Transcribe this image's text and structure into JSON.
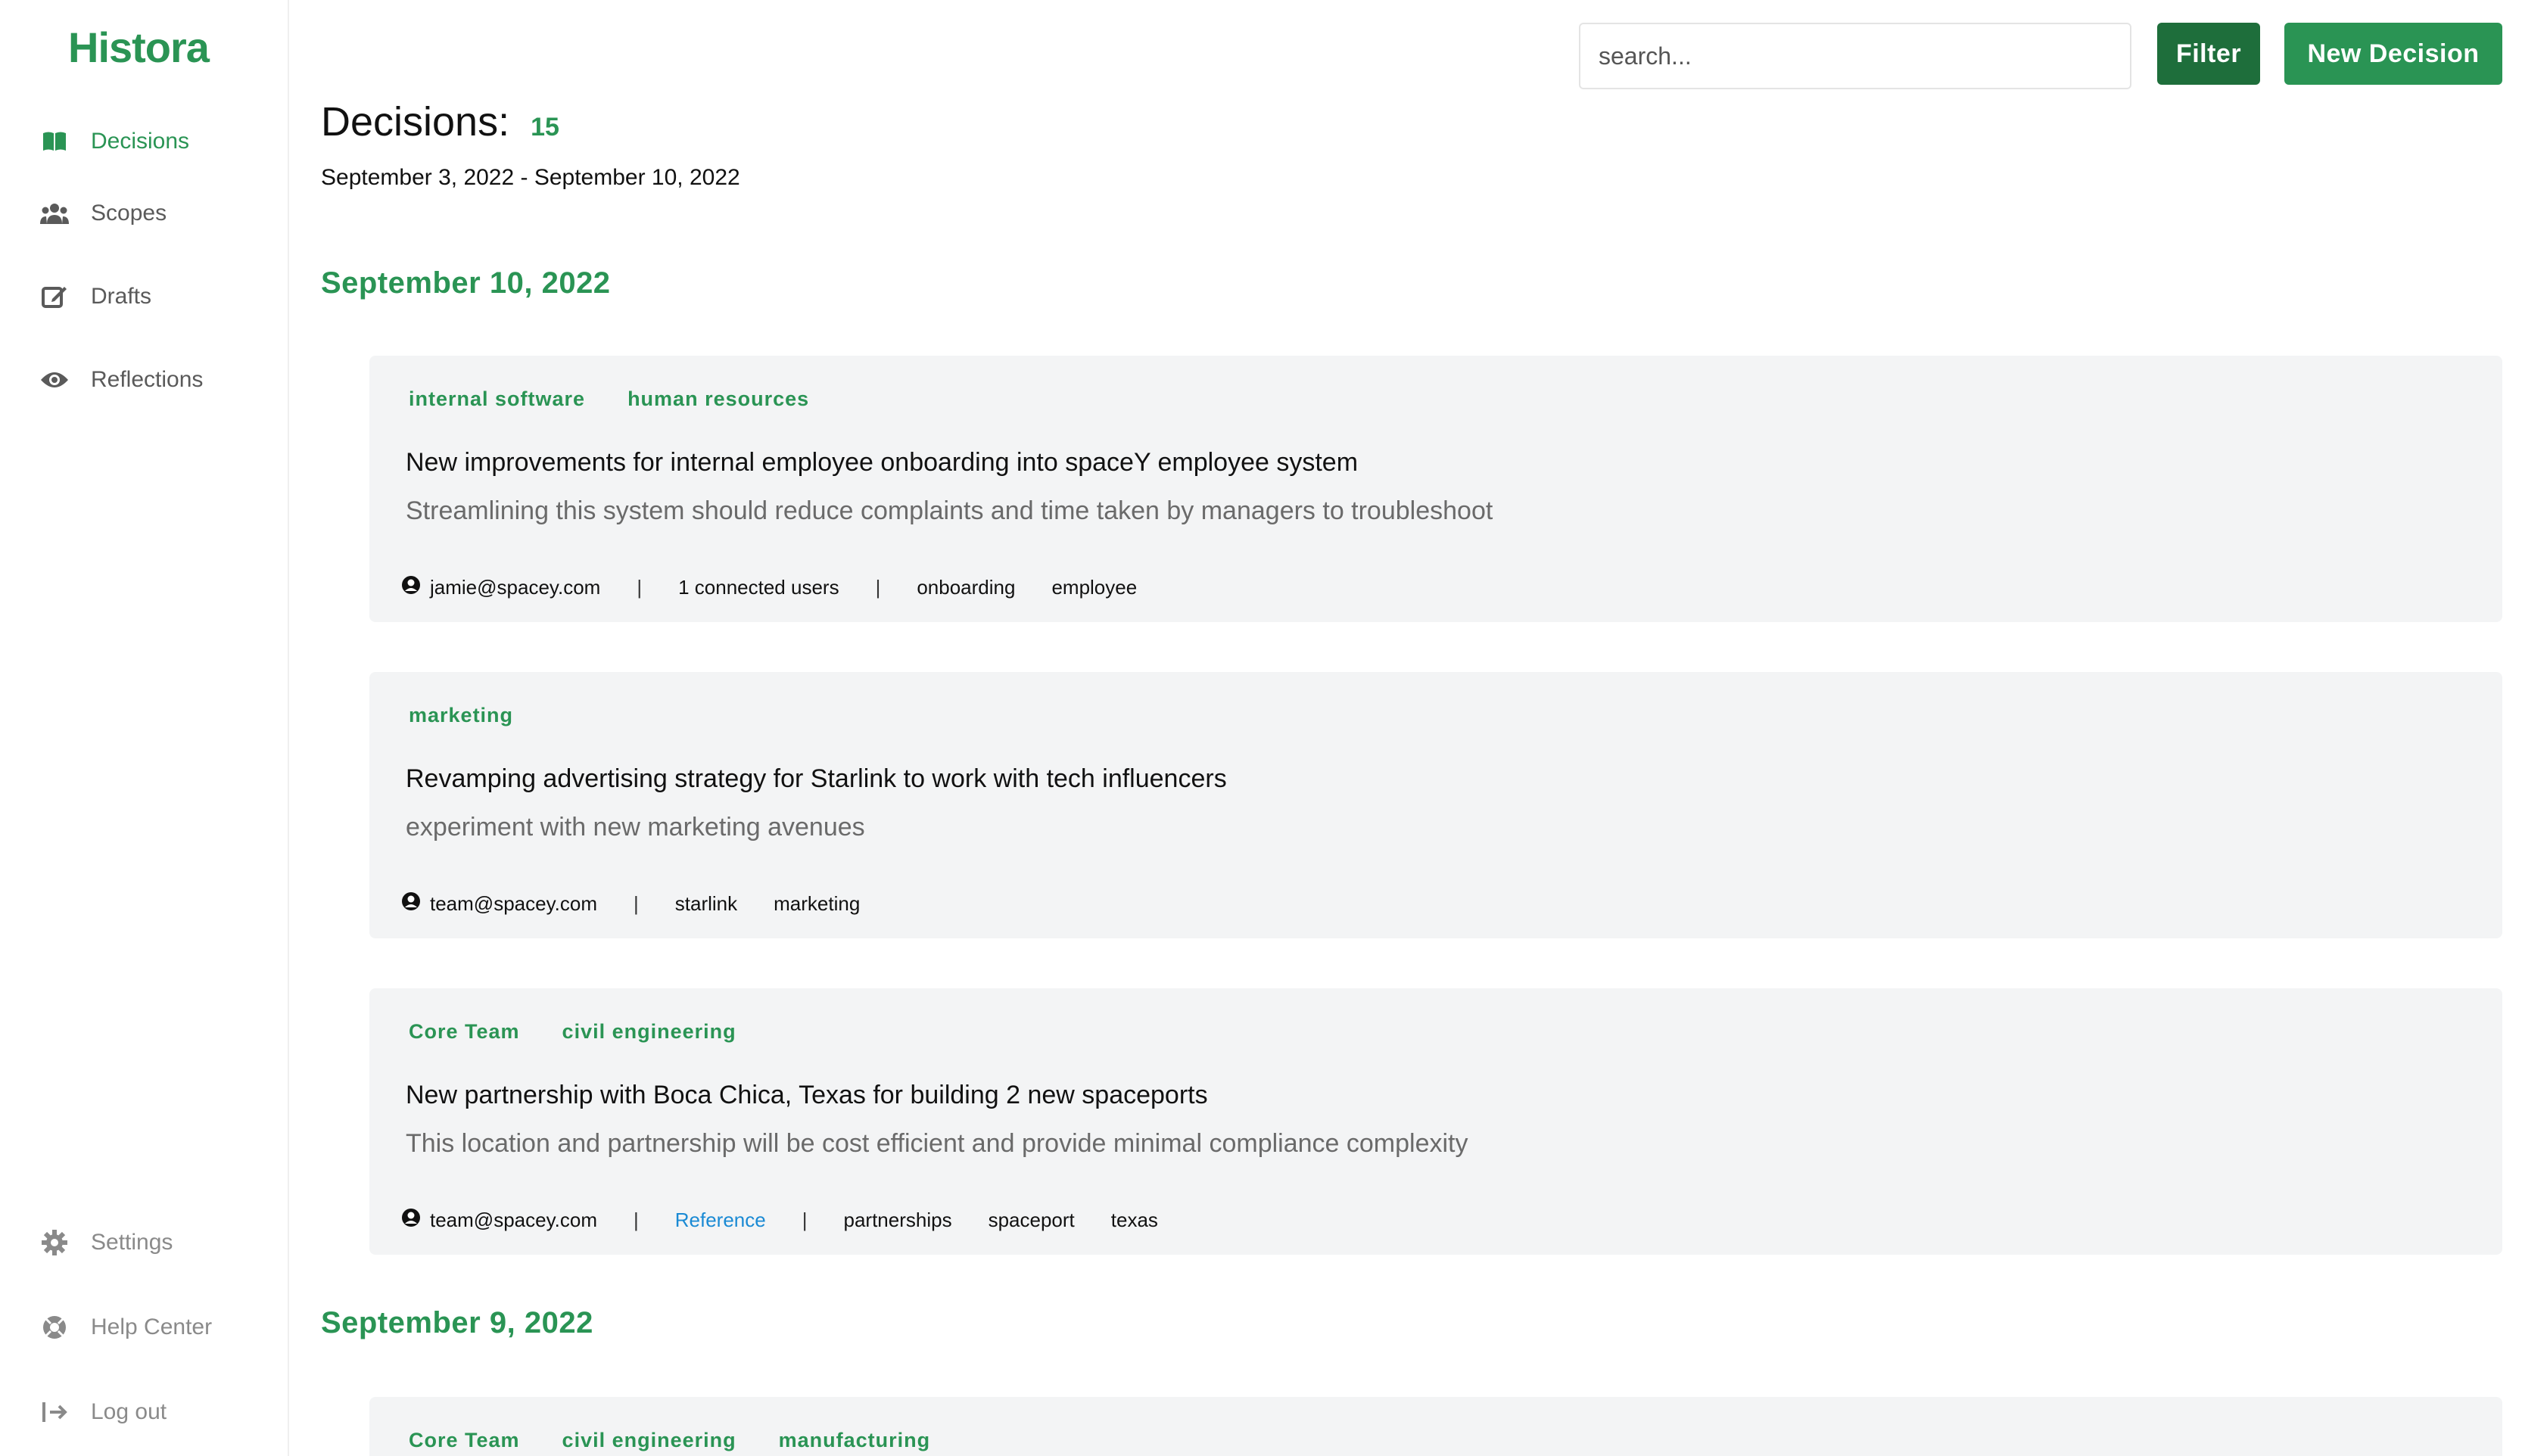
{
  "app": {
    "logo": "Histora"
  },
  "sidebar": {
    "items": [
      {
        "label": "Decisions",
        "icon": "book-open-icon"
      },
      {
        "label": "Scopes",
        "icon": "users-icon"
      },
      {
        "label": "Drafts",
        "icon": "edit-icon"
      },
      {
        "label": "Reflections",
        "icon": "eye-icon"
      }
    ],
    "bottom_items": [
      {
        "label": "Settings",
        "icon": "gear-icon"
      },
      {
        "label": "Help Center",
        "icon": "lifebuoy-icon"
      },
      {
        "label": "Log out",
        "icon": "logout-icon"
      }
    ]
  },
  "topbar": {
    "search_placeholder": "search...",
    "filter_label": "Filter",
    "new_label": "New Decision"
  },
  "header": {
    "title": "Decisions:",
    "count": "15",
    "date_range": "September 3, 2022 - September 10, 2022"
  },
  "groups": [
    {
      "date": "September 10, 2022",
      "cards": [
        {
          "tags": [
            "internal software",
            "human resources"
          ],
          "title": "New improvements for internal employee onboarding into spaceY employee system",
          "description": "Streamlining this system should reduce complaints and time taken by managers to troubleshoot",
          "user": "jamie@spacey.com",
          "connected": "1 connected users",
          "keywords": [
            "onboarding",
            "employee"
          ]
        },
        {
          "tags": [
            "marketing"
          ],
          "title": "Revamping advertising strategy for Starlink to work with tech influencers",
          "description": "experiment with new marketing avenues",
          "user": "team@spacey.com",
          "keywords": [
            "starlink",
            "marketing"
          ]
        },
        {
          "tags": [
            "Core Team",
            "civil engineering"
          ],
          "title": "New partnership with Boca Chica, Texas for building 2 new spaceports",
          "description": "This location and partnership will be cost efficient and provide minimal compliance complexity",
          "user": "team@spacey.com",
          "reference": "Reference",
          "keywords": [
            "partnerships",
            "spaceport",
            "texas"
          ]
        }
      ]
    },
    {
      "date": "September 9, 2022",
      "cards": [
        {
          "tags": [
            "Core Team",
            "civil engineering",
            "manufacturing"
          ]
        }
      ]
    }
  ],
  "colors": {
    "accent": "#2a9454",
    "accent_dark": "#1e6e3b",
    "card_bg": "#f3f4f5",
    "link": "#1a8ad4"
  }
}
